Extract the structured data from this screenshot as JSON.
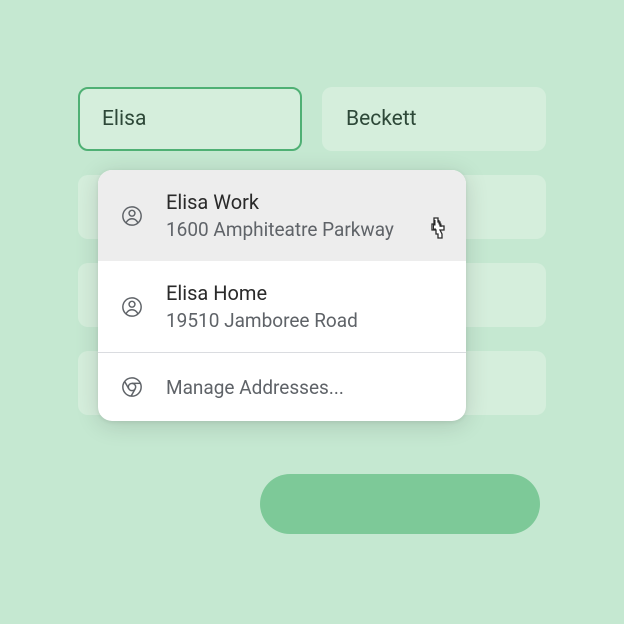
{
  "form": {
    "first_name": "Elisa",
    "last_name": "Beckett"
  },
  "dropdown": {
    "items": [
      {
        "title": "Elisa Work",
        "subtitle": "1600 Amphiteatre Parkway"
      },
      {
        "title": "Elisa Home",
        "subtitle": "19510 Jamboree Road"
      }
    ],
    "manage_label": "Manage Addresses..."
  }
}
